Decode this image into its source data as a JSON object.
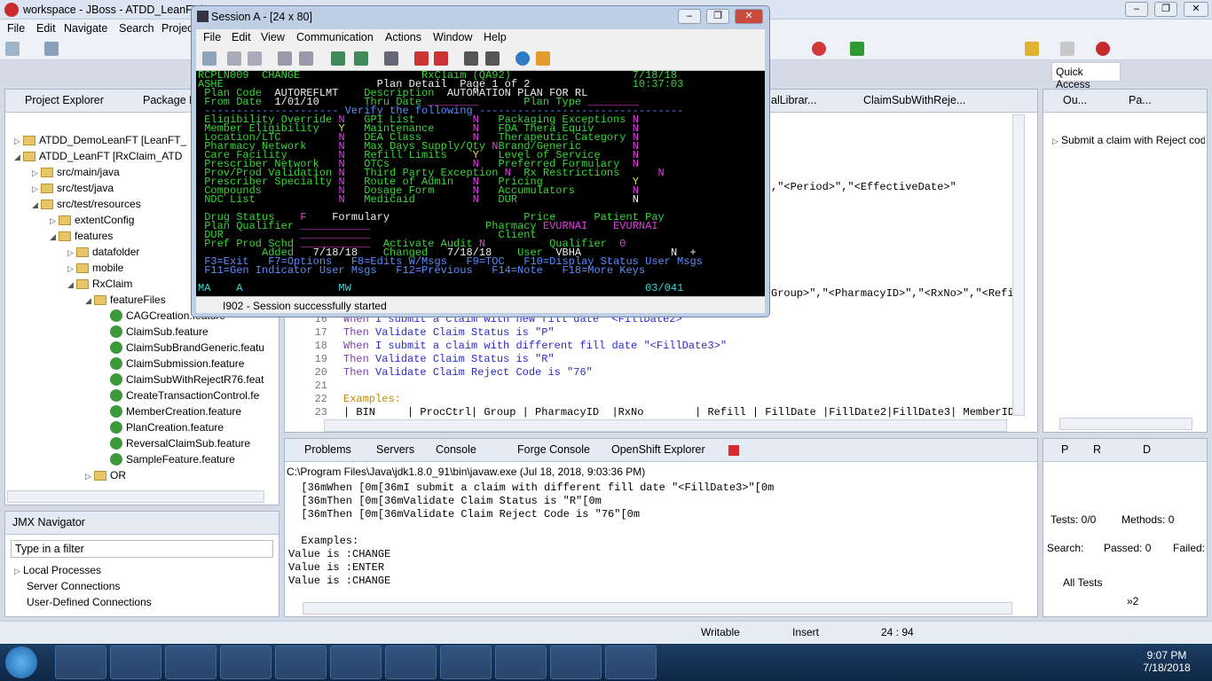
{
  "window": {
    "title": "workspace - JBoss - ATDD_LeanFT/"
  },
  "menubar": [
    "File",
    "Edit",
    "Navigate",
    "Search",
    "Projec"
  ],
  "quick_access": "Quick Access",
  "project_explorer": {
    "tabs": [
      "Project Explorer",
      "Package E"
    ],
    "items": [
      "ATDD_DemoLeanFT [LeanFT_",
      "ATDD_LeanFT [RxClaim_ATD",
      "src/main/java",
      "src/test/java",
      "src/test/resources",
      "extentConfig",
      "features",
      "datafolder",
      "mobile",
      "RxClaim",
      "featureFiles",
      "CAGCreation.feature",
      "ClaimSub.feature",
      "ClaimSubBrandGeneric.featu",
      "ClaimSubmission.feature",
      "ClaimSubWithRejectR76.feat",
      "CreateTransactionControl.fe",
      "MemberCreation.feature",
      "PlanCreation.feature",
      "ReversalClaimSub.feature",
      "SampleFeature.feature",
      "OR"
    ]
  },
  "jmx": {
    "title": "JMX Navigator",
    "filter_placeholder": "Type in a filter",
    "items": [
      "Local Processes",
      "Server Connections",
      "User-Defined Connections"
    ]
  },
  "editor": {
    "tabs": [
      "alLibrar...",
      "ClaimSubWithReje..."
    ],
    "frag1": ",\"<Period>\",\"<EffectiveDate>\"",
    "frag2": "Group>\",\"<PharmacyID>\",\"<RxNo>\",\"<Refi",
    "lines": [
      {
        "n": "16",
        "kw": "When",
        "text": " I submit a claim with new fill date \"<FillDate2>\""
      },
      {
        "n": "17",
        "kw": "Then",
        "text": " Validate Claim Status is \"P\""
      },
      {
        "n": "18",
        "kw": "When",
        "text": " I submit a claim with different fill date \"<FillDate3>\""
      },
      {
        "n": "19",
        "kw": "Then",
        "text": " Validate Claim Status is \"R\""
      },
      {
        "n": "20",
        "kw": "Then",
        "text": " Validate Claim Reject Code is \"76\""
      },
      {
        "n": "21",
        "kw": "",
        "text": ""
      },
      {
        "n": "22",
        "kw": "Examples:",
        "text": ""
      },
      {
        "n": "23",
        "kw": "",
        "text": "| BIN     | ProcCtrl| Group | PharmacyID  |RxNo        | Refill | FillDate |FillDate2|FillDate3| MemberID"
      }
    ]
  },
  "outline": {
    "tabs": [
      "Ou...",
      "Pa..."
    ],
    "item": "Submit a claim with Reject cod"
  },
  "console": {
    "tabs": [
      "Problems",
      "Servers",
      "Console",
      "Forge Console",
      "OpenShift Explorer"
    ],
    "header": "C:\\Program Files\\Java\\jdk1.8.0_91\\bin\\javaw.exe (Jul 18, 2018, 9:03:36 PM)",
    "lines": [
      "  \u001b[36mWhen \u001b[0m\u001b[36mI submit a claim with different fill date \"<FillDate3>\"\u001b[0m",
      "  \u001b[36mThen \u001b[0m\u001b[36mValidate Claim Status is \"R\"\u001b[0m",
      "  \u001b[36mThen \u001b[0m\u001b[36mValidate Claim Reject Code is \"76\"\u001b[0m",
      "",
      "  Examples:",
      "Value is :CHANGE",
      "Value is :ENTER",
      "Value is :CHANGE"
    ]
  },
  "junit": {
    "tabs": [
      "P",
      "R",
      "D"
    ],
    "tests": "Tests: 0/0",
    "methods": "Methods: 0",
    "search": "Search:",
    "passed": "Passed: 0",
    "failed": "Failed:",
    "all_tests": "All Tests",
    "more": "»2"
  },
  "statusbar": {
    "writable": "Writable",
    "insert": "Insert",
    "pos": "24 : 94"
  },
  "clock": {
    "time": "9:07 PM",
    "date": "7/18/2018"
  },
  "session": {
    "title": "Session A - [24 x 80]",
    "menu": [
      "File",
      "Edit",
      "View",
      "Communication",
      "Actions",
      "Window",
      "Help"
    ],
    "status": "I902 - Session successfully started",
    "screen": [
      [
        [
          "g",
          "RCPLN009  CHANGE                   RxClaim (QA92)                   7/18/18"
        ]
      ],
      [
        [
          "g",
          "ASHE                        "
        ],
        [
          "w",
          "Plan Detail  Page 1 of 2"
        ],
        [
          "g",
          "                10:37:03"
        ]
      ],
      [
        [
          "g",
          " Plan Code  "
        ],
        [
          "w",
          "AUTOREFLMT"
        ],
        [
          "g",
          "    Description  "
        ],
        [
          "w",
          "AUTOMATION PLAN FOR RL  "
        ]
      ],
      [
        [
          "g",
          " From Date  "
        ],
        [
          "w",
          "1/01/10"
        ],
        [
          "g",
          "       Thru Date "
        ],
        [
          "m",
          "________"
        ],
        [
          "g",
          "       Plan Type "
        ],
        [
          "m",
          "________"
        ]
      ],
      [
        [
          "b",
          " --------------------- Verify the following --------------------------------"
        ]
      ],
      [
        [
          "g",
          " Eligibility Override "
        ],
        [
          "m",
          "N"
        ],
        [
          "g",
          "   GPI List         "
        ],
        [
          "m",
          "N"
        ],
        [
          "g",
          "   Packaging Exceptions "
        ],
        [
          "m",
          "N"
        ]
      ],
      [
        [
          "g",
          " Member Eligibility   "
        ],
        [
          "y",
          "Y"
        ],
        [
          "g",
          "   Maintenance      "
        ],
        [
          "m",
          "N"
        ],
        [
          "g",
          "   FDA Thera Equiv      "
        ],
        [
          "m",
          "N"
        ]
      ],
      [
        [
          "g",
          " Location/LTC         "
        ],
        [
          "m",
          "N"
        ],
        [
          "g",
          "   DEA Class        "
        ],
        [
          "m",
          "N"
        ],
        [
          "g",
          "   Therapeutic Category "
        ],
        [
          "m",
          "N"
        ]
      ],
      [
        [
          "g",
          " Pharmacy Network     "
        ],
        [
          "m",
          "N"
        ],
        [
          "g",
          "   Max Days Supply/Qty "
        ],
        [
          "m",
          "N"
        ],
        [
          "g",
          "Brand/Generic        "
        ],
        [
          "m",
          "N"
        ]
      ],
      [
        [
          "g",
          " Care Facility        "
        ],
        [
          "m",
          "N"
        ],
        [
          "g",
          "   Refill Limits    "
        ],
        [
          "y",
          "Y"
        ],
        [
          "g",
          "   Level of Service     "
        ],
        [
          "m",
          "N"
        ]
      ],
      [
        [
          "g",
          " Prescriber Network   "
        ],
        [
          "m",
          "N"
        ],
        [
          "g",
          "   OTCs             "
        ],
        [
          "m",
          "N"
        ],
        [
          "g",
          "   Preferred Formulary  "
        ],
        [
          "m",
          "N"
        ]
      ],
      [
        [
          "g",
          " Prov/Prod Validation "
        ],
        [
          "m",
          "N"
        ],
        [
          "g",
          "   Third Party Exception "
        ],
        [
          "m",
          "N"
        ],
        [
          "g",
          "  Rx Restrictions      "
        ],
        [
          "m",
          "N"
        ]
      ],
      [
        [
          "g",
          " Prescriber Specialty "
        ],
        [
          "m",
          "N"
        ],
        [
          "g",
          "   Route of Admin   "
        ],
        [
          "m",
          "N"
        ],
        [
          "g",
          "   Pricing              "
        ],
        [
          "y",
          "Y"
        ]
      ],
      [
        [
          "g",
          " Compounds            "
        ],
        [
          "m",
          "N"
        ],
        [
          "g",
          "   Dosage Form      "
        ],
        [
          "m",
          "N"
        ],
        [
          "g",
          "   Accumulators         "
        ],
        [
          "m",
          "N"
        ]
      ],
      [
        [
          "g",
          " NDC List             "
        ],
        [
          "m",
          "N"
        ],
        [
          "g",
          "   Medicaid         "
        ],
        [
          "m",
          "N"
        ],
        [
          "g",
          "   DUR                  "
        ],
        [
          "w",
          "N"
        ]
      ],
      [
        [
          "g",
          " "
        ]
      ],
      [
        [
          "g",
          " Drug Status    "
        ],
        [
          "m",
          "F"
        ],
        [
          "w",
          "    Formulary"
        ],
        [
          "g",
          "                     Price      Patient Pay"
        ]
      ],
      [
        [
          "g",
          " Plan Qualifier "
        ],
        [
          "m",
          "___________"
        ],
        [
          "g",
          "                  Pharmacy "
        ],
        [
          "m",
          "EVURNAI"
        ],
        [
          "g",
          "    "
        ],
        [
          "m",
          "EVURNAI"
        ]
      ],
      [
        [
          "g",
          " DUR            "
        ],
        [
          "m",
          "___________"
        ],
        [
          "g",
          "                    Client"
        ]
      ],
      [
        [
          "g",
          " Pref Prod Schd "
        ],
        [
          "m",
          "___________"
        ],
        [
          "g",
          "  Activate Audit "
        ],
        [
          "m",
          "N"
        ],
        [
          "g",
          "          Qualifier  "
        ],
        [
          "m",
          "0"
        ]
      ],
      [
        [
          "g",
          "          Added   "
        ],
        [
          "w",
          "7/18/18"
        ],
        [
          "g",
          "    Changed   "
        ],
        [
          "w",
          "7/18/18"
        ],
        [
          "g",
          "    User  "
        ],
        [
          "w",
          "VBHA"
        ],
        [
          "g",
          "              "
        ],
        [
          "w",
          "N  +"
        ]
      ],
      [
        [
          "b",
          " F3=Exit   F7=Options   F8=Edits W/Msgs   F9=TOC   F10=Display Status User Msgs"
        ]
      ],
      [
        [
          "b",
          " F11=Gen Indicator User Msgs   F12=Previous   F14=Note   F18=More Keys"
        ]
      ],
      [
        [
          "b",
          "  "
        ]
      ],
      [
        [
          "c",
          "MA    A               MW                                              03/041"
        ]
      ]
    ]
  }
}
